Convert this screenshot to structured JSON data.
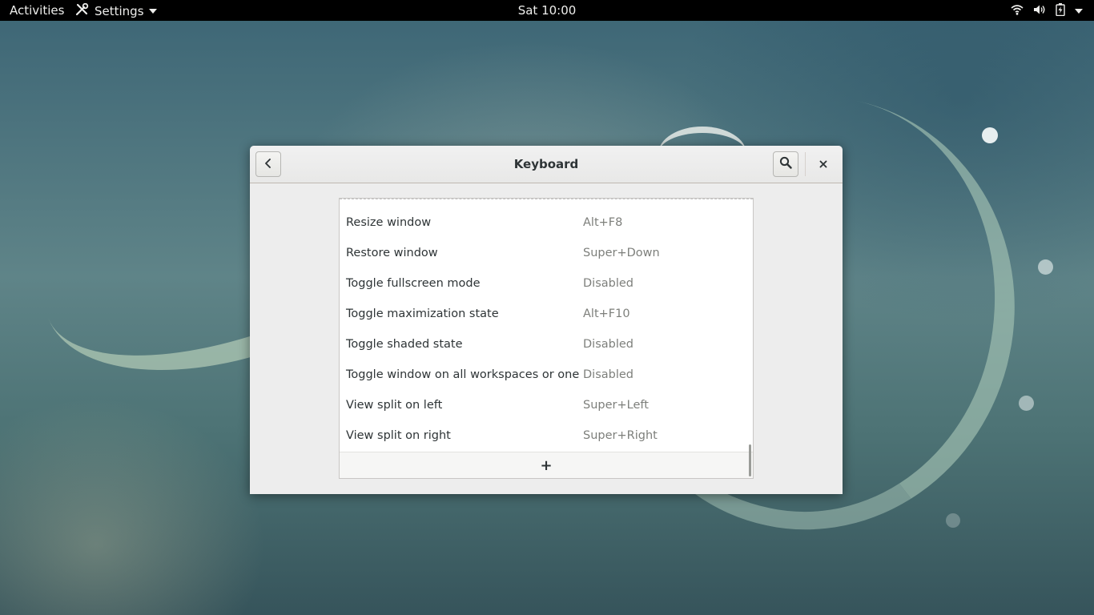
{
  "topbar": {
    "activities": "Activities",
    "app_menu": "Settings",
    "clock": "Sat 10:00",
    "status_icons": [
      "wifi-icon",
      "volume-icon",
      "battery-icon",
      "chevron-down-icon"
    ]
  },
  "window": {
    "title": "Keyboard",
    "back_icon": "chevron-left-icon",
    "search_icon": "search-icon",
    "close_icon": "close-icon"
  },
  "shortcuts": [
    {
      "name": "Resize window",
      "accel": "Alt+F8"
    },
    {
      "name": "Restore window",
      "accel": "Super+Down"
    },
    {
      "name": "Toggle fullscreen mode",
      "accel": "Disabled"
    },
    {
      "name": "Toggle maximization state",
      "accel": "Alt+F10"
    },
    {
      "name": "Toggle shaded state",
      "accel": "Disabled"
    },
    {
      "name": "Toggle window on all workspaces or one",
      "accel": "Disabled"
    },
    {
      "name": "View split on left",
      "accel": "Super+Left"
    },
    {
      "name": "View split on right",
      "accel": "Super+Right"
    }
  ],
  "add_row": {
    "label": "+"
  },
  "colors": {
    "topbar_bg": "#000000",
    "window_bg": "#ededed",
    "accel_text": "#7d7f7b"
  }
}
